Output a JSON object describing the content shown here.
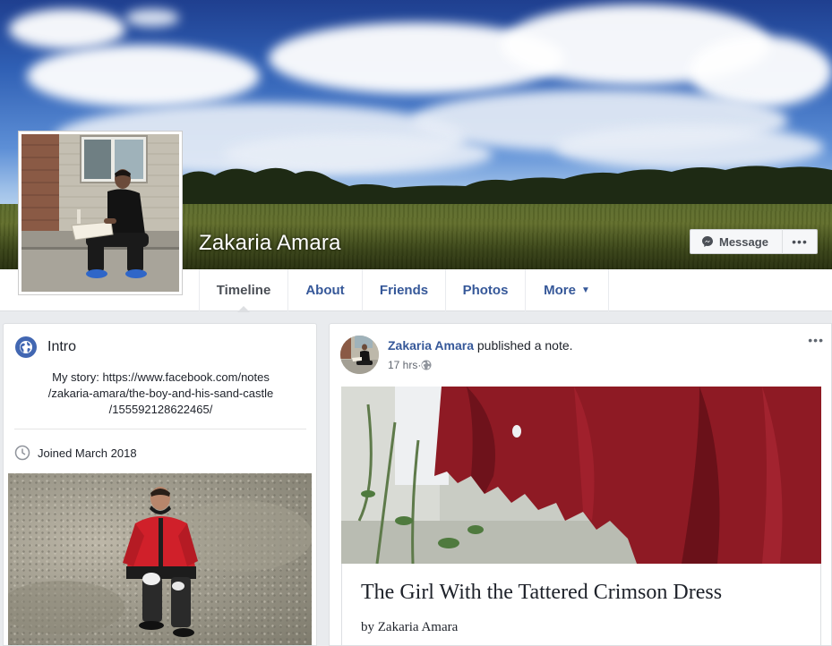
{
  "profile": {
    "name": "Zakaria Amara",
    "message_label": "Message",
    "more_label": "•••"
  },
  "nav": {
    "tabs": [
      {
        "label": "Timeline",
        "active": true
      },
      {
        "label": "About"
      },
      {
        "label": "Friends"
      },
      {
        "label": "Photos"
      },
      {
        "label": "More"
      }
    ]
  },
  "intro": {
    "title": "Intro",
    "story_line1": "My story: https://www.facebook.com/notes",
    "story_line2": "/zakaria-amara/the-boy-and-his-sand-castle",
    "story_line3": "/155592128622465/",
    "joined": "Joined March 2018"
  },
  "post": {
    "author": "Zakaria Amara",
    "action": " published a note.",
    "time": "17 hrs",
    "separator": " · ",
    "menu": "•••",
    "note_title": "The Girl With the Tattered Crimson Dress",
    "note_byline": "by Zakaria Amara"
  },
  "colors": {
    "link_blue": "#365899",
    "brand_blue": "#4267b2",
    "background": "#e9ebee"
  },
  "icons": {
    "message": "messenger-icon",
    "intro": "globe-icon",
    "joined": "clock-icon",
    "privacy": "globe-small-icon",
    "more": "caret-down-icon"
  }
}
